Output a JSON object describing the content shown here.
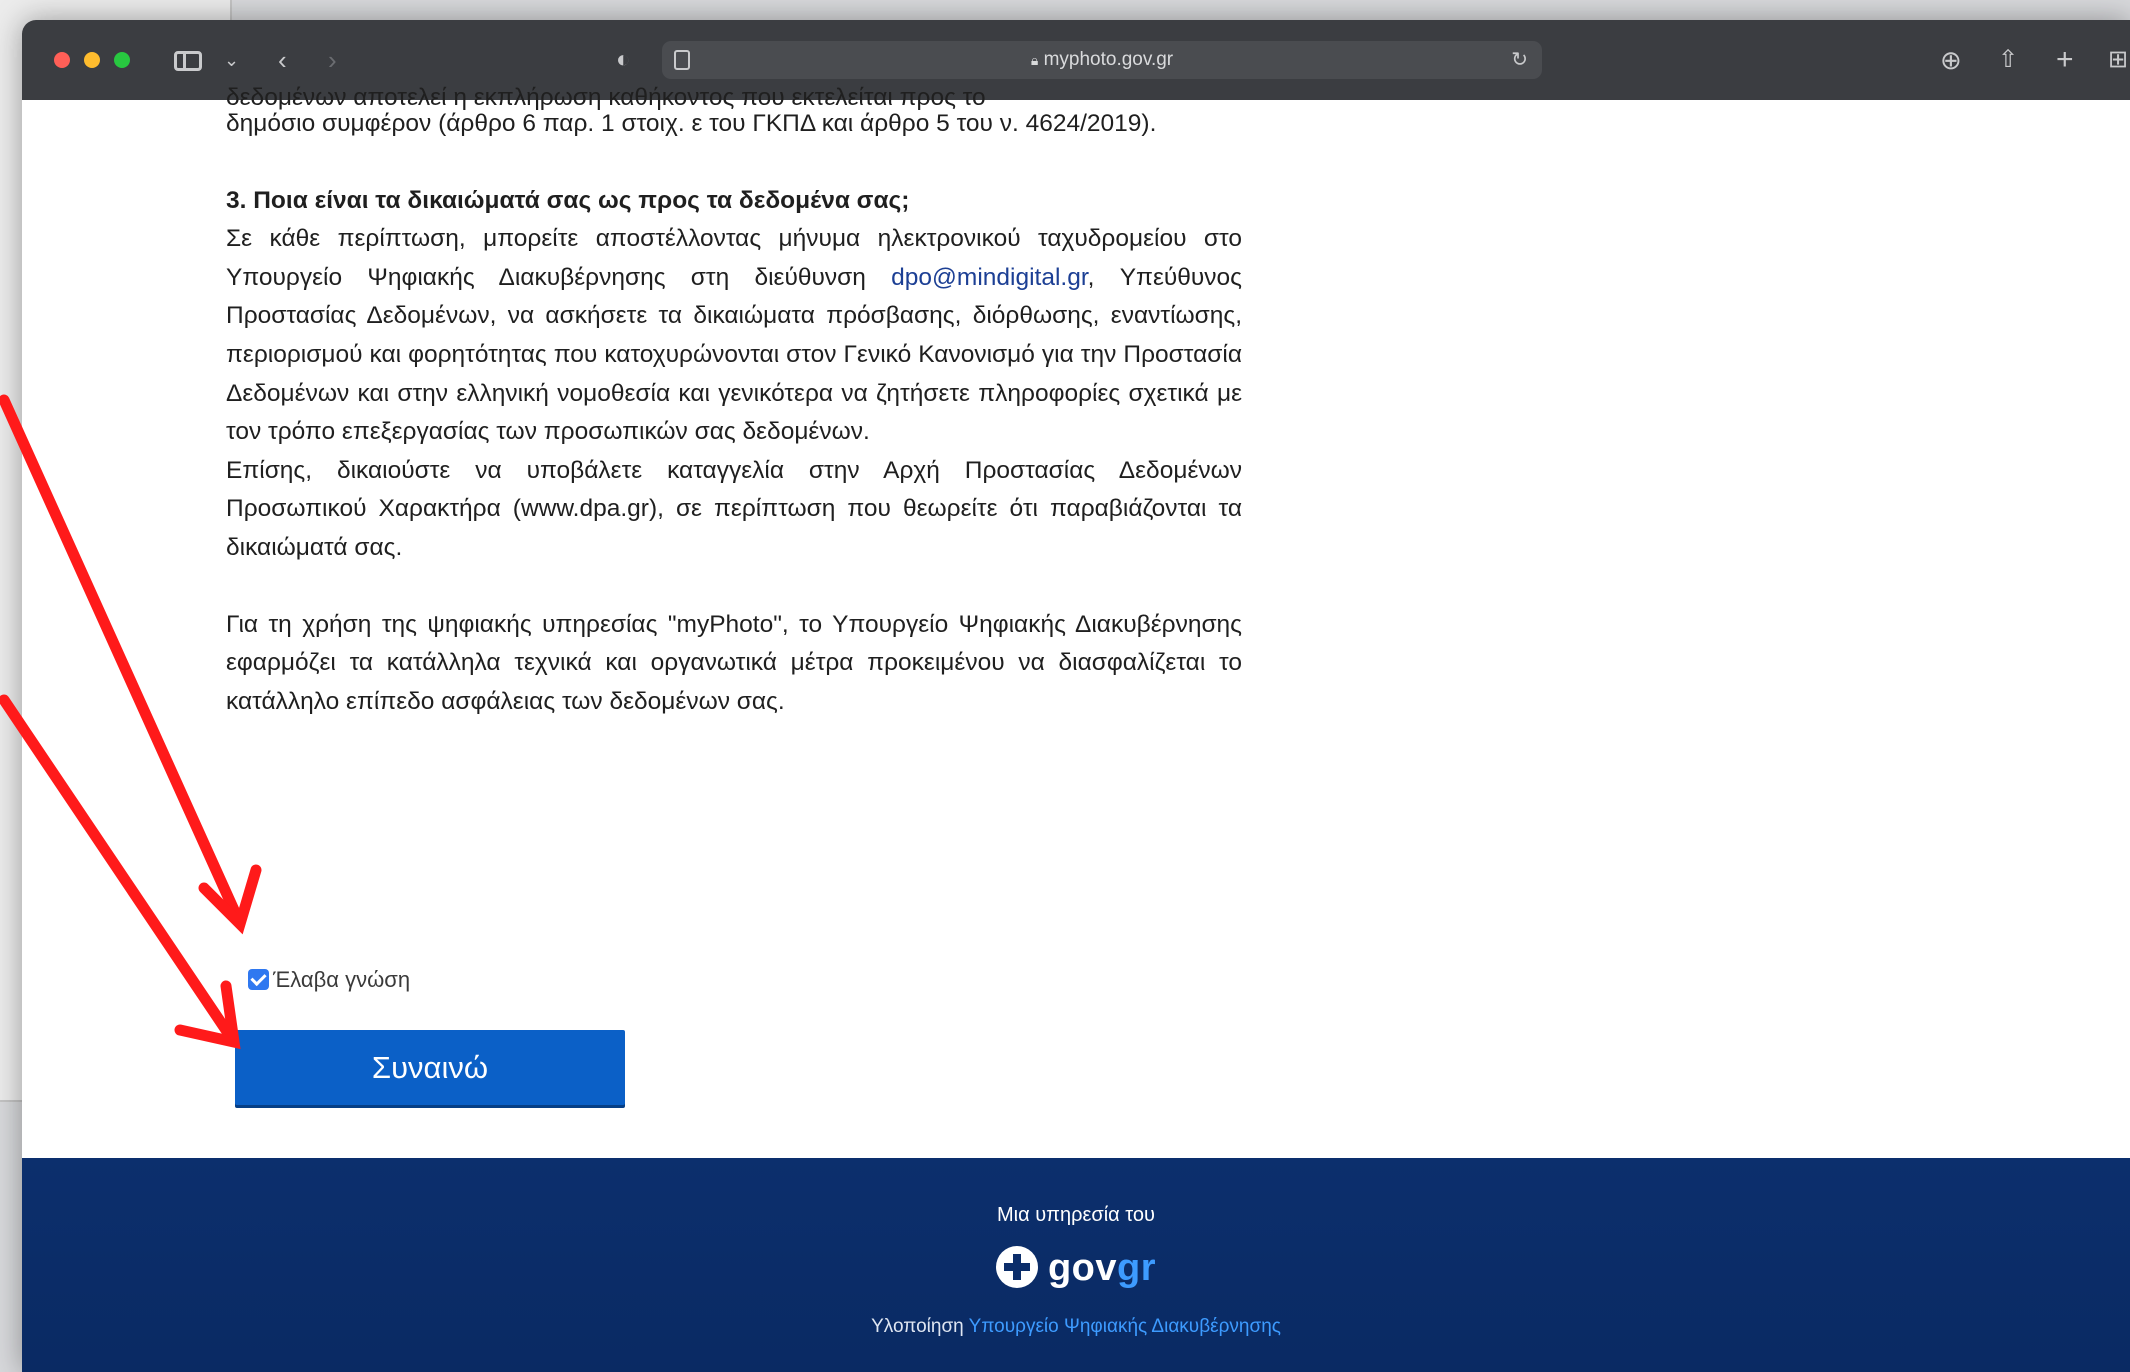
{
  "browser": {
    "url": "myphoto.gov.gr",
    "icons": [
      "shield-icon",
      "reader-icon",
      "lock-icon",
      "reload-icon",
      "download-icon",
      "share-icon",
      "new-tab-icon",
      "tab-overview-icon"
    ]
  },
  "page": {
    "cutoff_line": "δεδομένων αποτελεί η εκπλήρωση καθήκοντος που εκτελείται προς το",
    "intro": "δημόσιο συμφέρον (άρθρο 6 παρ. 1 στοιχ. ε του ΓΚΠΔ και άρθρο 5 του ν. 4624/2019).",
    "section3_heading": "3. Ποια είναι τα δικαιώματά σας ως προς τα δεδομένα σας;",
    "section3_part1": "Σε κάθε περίπτωση, μπορείτε αποστέλλοντας μήνυμα ηλεκτρονικού ταχυδρομείου στο Υπουργείο Ψηφιακής Διακυβέρνησης στη διεύθυνση",
    "section3_email": "dpo@mindigital.gr",
    "section3_part2": ", Υπεύθυνος Προστασίας Δεδομένων, να ασκήσετε τα δικαιώματα πρόσβασης, διόρθωσης, εναντίωσης, περιορισμού και φορητότητας που κατοχυρώνονται στον Γενικό Κανονισμό για την Προστασία Δεδομένων και στην ελληνική νομοθεσία και γενικότερα να ζητήσετε πληροφορίες σχετικά με τον τρόπο επεξεργασίας των προσωπικών σας δεδομένων.",
    "section3_complaint": "Επίσης, δικαιούστε να υποβάλετε καταγγελία στην Αρχή Προστασίας Δεδομένων Προσωπικού Χαρακτήρα (www.dpa.gr), σε περίπτωση που θεωρείτε ότι παραβιάζονται τα δικαιώματά σας.",
    "security_paragraph": "Για τη χρήση της ψηφιακής υπηρεσίας \"myPhoto\", το Υπουργείο Ψηφιακής Διακυβέρνησης εφαρμόζει τα κατάλληλα τεχνικά και οργανωτικά μέτρα προκειμένου να διασφαλίζεται το κατάλληλο επίπεδο ασφάλειας των δεδομένων σας.",
    "checkbox_label": "Έλαβα γνώση",
    "checkbox_checked": true,
    "agree_button": "Συναινώ"
  },
  "footer": {
    "service_of": "Μια υπηρεσία του",
    "logo_gov": "gov",
    "logo_gr": "gr",
    "credit_prefix": "Υλοποίηση",
    "credit_link": "Υπουργείο Ψηφιακής Διακυβέρνησης"
  },
  "colors": {
    "toolbar": "#3b3d41",
    "button": "#0b60c7",
    "footer": "#0b2d6a",
    "annotation_arrow": "#ff1a1a",
    "link": "#1c3f94"
  }
}
